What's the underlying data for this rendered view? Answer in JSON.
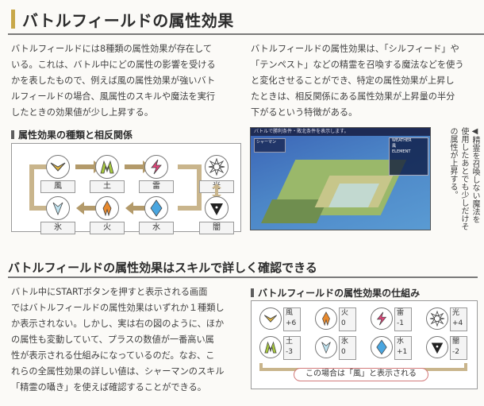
{
  "header": {
    "title": "バトルフィールドの属性効果"
  },
  "intro": {
    "left_lines": [
      "バトルフィールドには8種類の属性効果が存在して",
      "いる。これは、バトル中にどの属性の影響を受ける",
      "かを表したもので、例えば風の属性効果が強いバト",
      "ルフィールドの場合、風属性のスキルや魔法を実行",
      "したときの効果値が少し上昇する。"
    ],
    "right_lines": [
      "バトルフィールドの属性効果は、「シルフィード」や",
      "「テンペスト」などの精霊を召喚する魔法などを使う",
      "と変化させることができ、特定の属性効果が上昇し",
      "たときは、相反関係にある属性効果が上昇量の半分",
      "下がるという特徴がある。"
    ]
  },
  "relations": {
    "heading": "属性効果の種類と相反関係",
    "elements": [
      {
        "label": "風",
        "icon": "wind-icon"
      },
      {
        "label": "土",
        "icon": "earth-icon"
      },
      {
        "label": "雷",
        "icon": "thunder-icon"
      },
      {
        "label": "光",
        "icon": "light-icon"
      },
      {
        "label": "氷",
        "icon": "ice-icon"
      },
      {
        "label": "火",
        "icon": "fire-icon"
      },
      {
        "label": "水",
        "icon": "water-icon"
      },
      {
        "label": "闇",
        "icon": "dark-icon"
      }
    ]
  },
  "screenshot": {
    "top_text": "バトルで勝利条件・敗北条件を表示します。",
    "panel_lines": [
      "WEATHER",
      "風",
      "ELEMENT"
    ],
    "unit_label": "シャーマン"
  },
  "caption": "◀精霊を召喚しない魔法を使用したあとでも少しだけその属性が上昇する。",
  "section2": {
    "title": "バトルフィールドの属性効果はスキルで詳しく確認できる",
    "lines": [
      "バトル中にSTARTボタンを押すと表示される画面",
      "ではバトルフィールドの属性効果はいずれか１種類し",
      "か表示されない。しかし、実は右の図のように、ほか",
      "の属性も変動していて、プラスの数値が一番高い属",
      "性が表示される仕組みになっているのだ。なお、こ",
      "れらの全属性効果の詳しい値は、シャーマンのスキル",
      "「精霊の囁き」を使えば確認することができる。"
    ]
  },
  "mechanism": {
    "heading": "バトルフィールドの属性効果の仕組み",
    "cells": [
      {
        "name": "風",
        "value": "+6",
        "icon": "wind-icon"
      },
      {
        "name": "火",
        "value": "0",
        "icon": "fire-icon"
      },
      {
        "name": "雷",
        "value": "-1",
        "icon": "thunder-icon"
      },
      {
        "name": "光",
        "value": "+4",
        "icon": "light-icon"
      },
      {
        "name": "土",
        "value": "-3",
        "icon": "earth-icon"
      },
      {
        "name": "氷",
        "value": "0",
        "icon": "ice-icon"
      },
      {
        "name": "水",
        "value": "+1",
        "icon": "water-icon"
      },
      {
        "name": "闇",
        "value": "-2",
        "icon": "dark-icon"
      }
    ],
    "note": "この場合は「風」と表示される"
  },
  "colors": {
    "accent": "#c8a84a",
    "arrow": "#b39a6a",
    "pill_border": "#d27a7a"
  }
}
